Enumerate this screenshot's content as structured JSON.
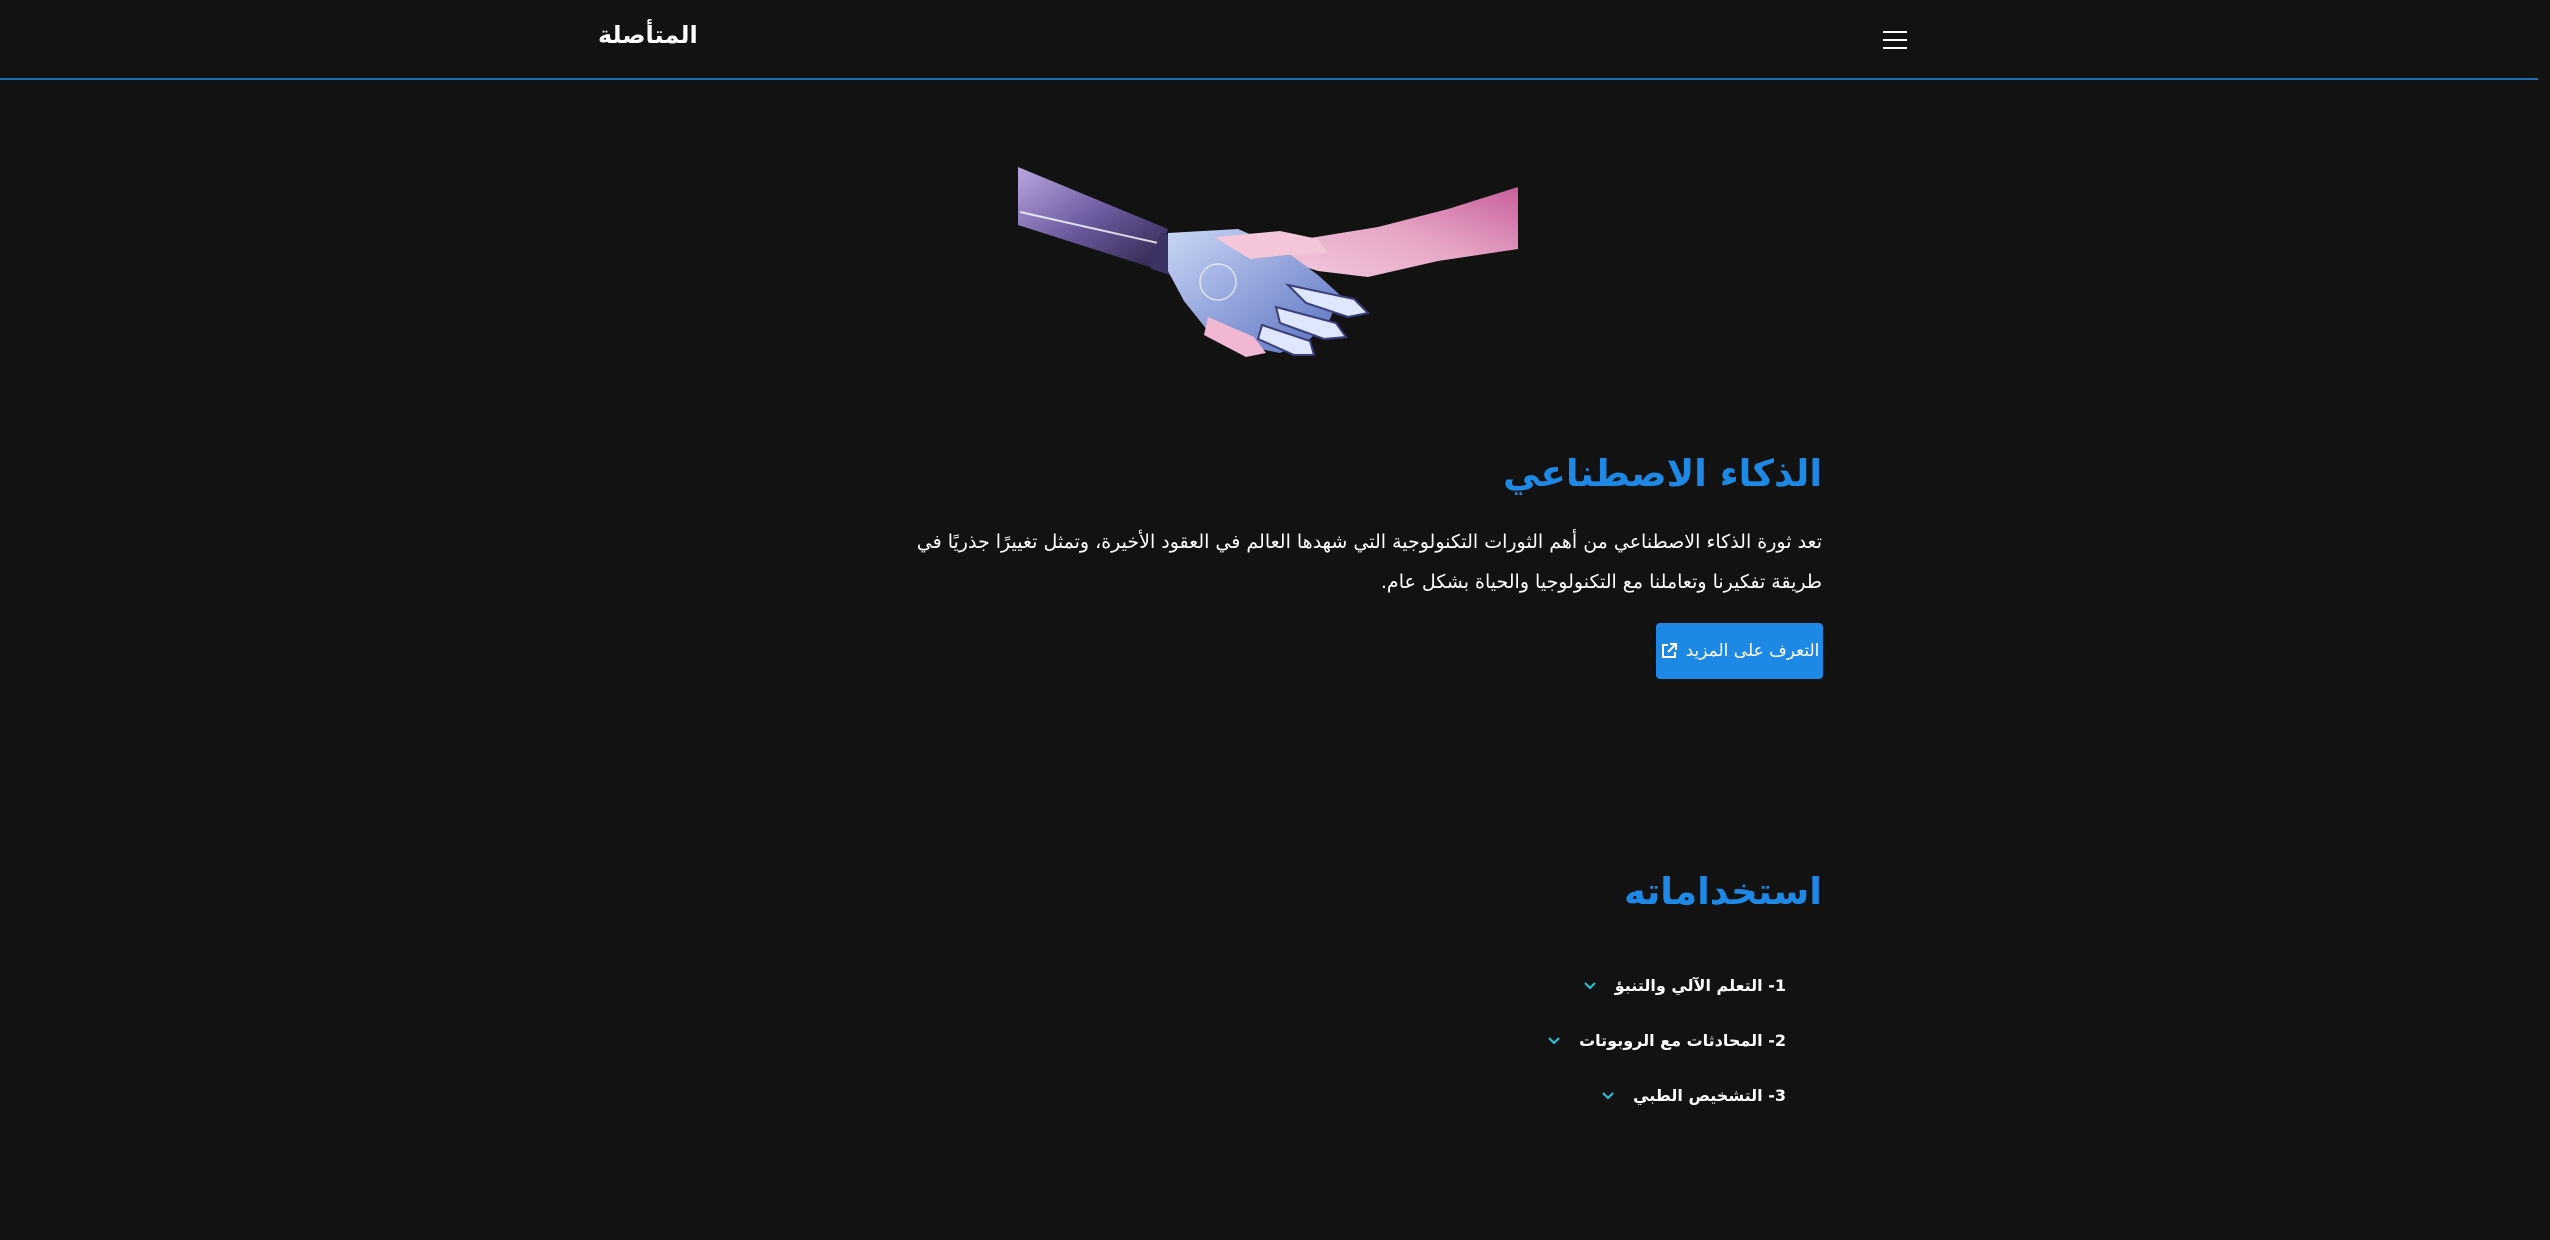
{
  "navbar": {
    "brand": "المتأصلة",
    "menu_icon": "hamburger-menu-icon"
  },
  "hero": {
    "image": "robot-human-handshake-image"
  },
  "intro": {
    "title": "الذكاء الاصطناعي",
    "paragraph": "تعد ثورة الذكاء الاصطناعي من أهم الثورات التكنولوجية التي شهدها العالم في العقود الأخيرة، وتمثل تغييرًا جذريًا في طريقة تفكيرنا وتعاملنا مع التكنولوجيا والحياة بشكل عام.",
    "learn_more_label": "التعرف على المزيد",
    "learn_more_icon": "external-link-icon"
  },
  "uses": {
    "title": "استخداماته",
    "items": [
      {
        "label": "1- التعلم الآلي والتنبؤ"
      },
      {
        "label": "2- المحادثات مع الروبوتات"
      },
      {
        "label": "3- التشخيص الطبي"
      }
    ],
    "chevron_icon": "chevron-down-icon"
  },
  "colors": {
    "background": "#121213",
    "accent": "#1e88e5",
    "text": "#ffffff",
    "navbar_border": "#1f6db5",
    "chevron": "#26c6da"
  }
}
